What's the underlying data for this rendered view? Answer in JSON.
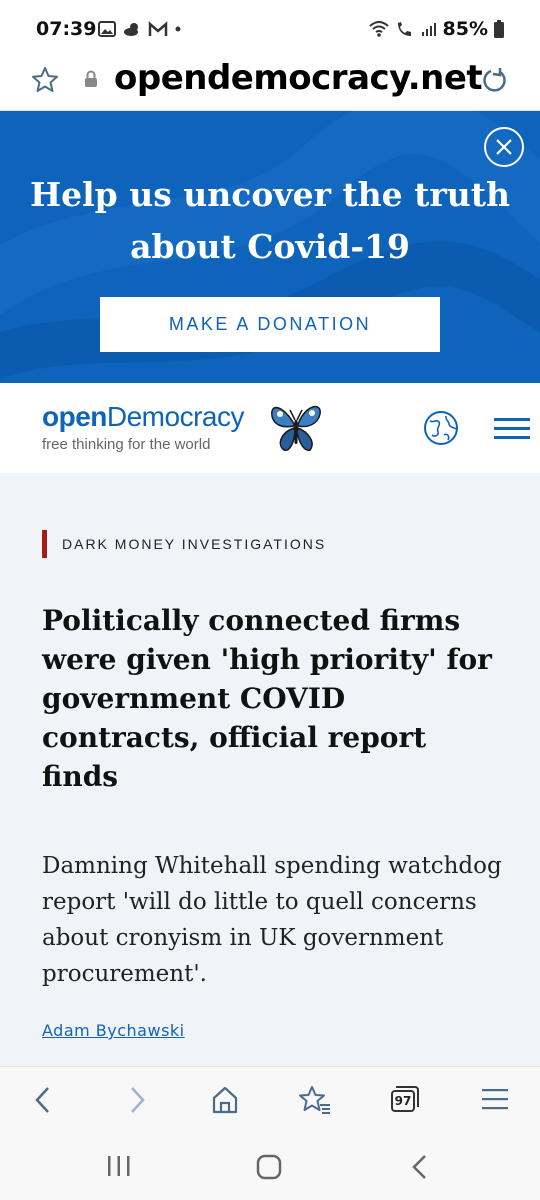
{
  "status_bar": {
    "time": "07:39",
    "battery": "85%"
  },
  "url_bar": {
    "url": "opendemocracy.net"
  },
  "banner": {
    "title_line1": "Help us uncover the truth",
    "title_line2": "about Covid-19",
    "donate_label": "MAKE A DONATION"
  },
  "site_header": {
    "logo_open": "open",
    "logo_democracy": "Democracy",
    "tagline": "free thinking for the world"
  },
  "article": {
    "section": "DARK MONEY INVESTIGATIONS",
    "headline": "Politically connected firms were given 'high priority' for government COVID contracts, official report finds",
    "standfirst": "Damning Whitehall spending watchdog report 'will do little to quell concerns about cronyism in UK government procurement'.",
    "author": "Adam Bychawski"
  },
  "browser_toolbar": {
    "tabs_count": "97"
  },
  "colors": {
    "brand_blue": "#0e63bb",
    "section_red": "#a31c1c"
  },
  "icons": [
    "gallery-icon",
    "weather-icon",
    "gmail-icon",
    "wifi-icon",
    "wifi-call-icon",
    "signal-icon",
    "battery-icon",
    "star-icon",
    "lock-icon",
    "reload-icon",
    "close-icon",
    "butterfly-icon",
    "globe-icon",
    "menu-icon",
    "back-icon",
    "forward-icon",
    "home-icon",
    "bookmarks-icon",
    "tabs-icon",
    "browser-menu-icon",
    "recents-icon",
    "home-circle-icon",
    "nav-back-icon"
  ]
}
